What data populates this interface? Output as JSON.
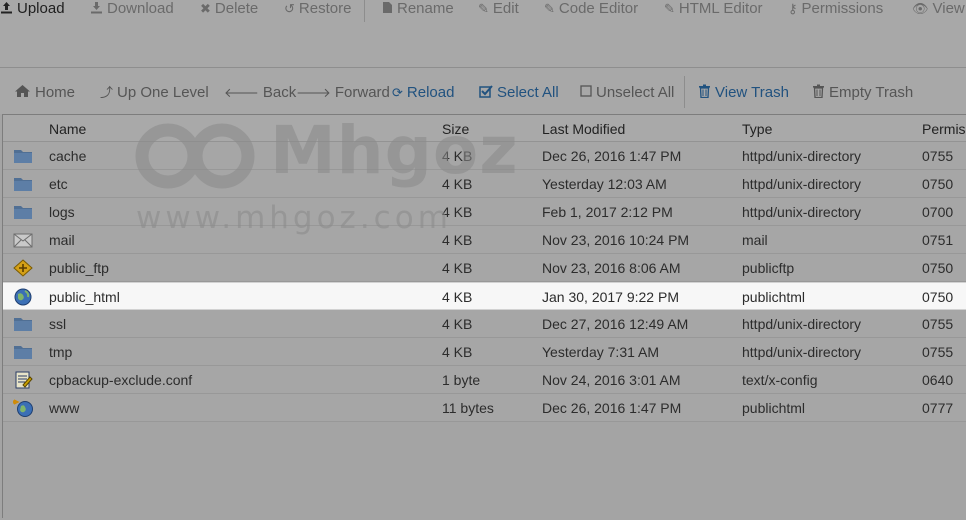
{
  "toolbar": {
    "upload": "Upload",
    "download": "Download",
    "delete": "Delete",
    "restore": "Restore",
    "rename": "Rename",
    "edit": "Edit",
    "code_editor": "Code Editor",
    "html_editor": "HTML Editor",
    "permissions": "Permissions",
    "view": "View"
  },
  "nav": {
    "home": "Home",
    "up_one_level": "Up One Level",
    "back": "Back",
    "forward": "Forward",
    "reload": "Reload",
    "select_all": "Select All",
    "unselect_all": "Unselect All",
    "view_trash": "View Trash",
    "empty_trash": "Empty Trash"
  },
  "table": {
    "headers": {
      "name": "Name",
      "size": "Size",
      "last_modified": "Last Modified",
      "type": "Type",
      "permissions": "Permis"
    },
    "rows": [
      {
        "icon": "folder-icon",
        "name": "cache",
        "size": "4 KB",
        "modified": "Dec 26, 2016 1:47 PM",
        "type": "httpd/unix-directory",
        "perm": "0755"
      },
      {
        "icon": "folder-icon",
        "name": "etc",
        "size": "4 KB",
        "modified": "Yesterday 12:03 AM",
        "type": "httpd/unix-directory",
        "perm": "0750"
      },
      {
        "icon": "folder-icon",
        "name": "logs",
        "size": "4 KB",
        "modified": "Feb 1, 2017 2:12 PM",
        "type": "httpd/unix-directory",
        "perm": "0700"
      },
      {
        "icon": "mail-icon",
        "name": "mail",
        "size": "4 KB",
        "modified": "Nov 23, 2016 10:24 PM",
        "type": "mail",
        "perm": "0751"
      },
      {
        "icon": "ftp-icon",
        "name": "public_ftp",
        "size": "4 KB",
        "modified": "Nov 23, 2016 8:06 AM",
        "type": "publicftp",
        "perm": "0750"
      },
      {
        "icon": "globe-icon",
        "name": "public_html",
        "size": "4 KB",
        "modified": "Jan 30, 2017 9:22 PM",
        "type": "publichtml",
        "perm": "0750"
      },
      {
        "icon": "folder-icon",
        "name": "ssl",
        "size": "4 KB",
        "modified": "Dec 27, 2016 12:49 AM",
        "type": "httpd/unix-directory",
        "perm": "0755"
      },
      {
        "icon": "folder-icon",
        "name": "tmp",
        "size": "4 KB",
        "modified": "Yesterday 7:31 AM",
        "type": "httpd/unix-directory",
        "perm": "0755"
      },
      {
        "icon": "config-file-icon",
        "name": "cpbackup-exclude.conf",
        "size": "1 byte",
        "modified": "Nov 24, 2016 3:01 AM",
        "type": "text/x-config",
        "perm": "0640"
      },
      {
        "icon": "globe-link-icon",
        "name": "www",
        "size": "11 bytes",
        "modified": "Dec 26, 2016 1:47 PM",
        "type": "publichtml",
        "perm": "0777"
      }
    ]
  },
  "watermark": {
    "brand": "Mhgoz",
    "url": "www.mhgoz.com"
  },
  "colors": {
    "background": "#a4a4a4",
    "link_blue": "#21527f",
    "selected_row": "#f7f7f7",
    "folder": "#506f94"
  }
}
